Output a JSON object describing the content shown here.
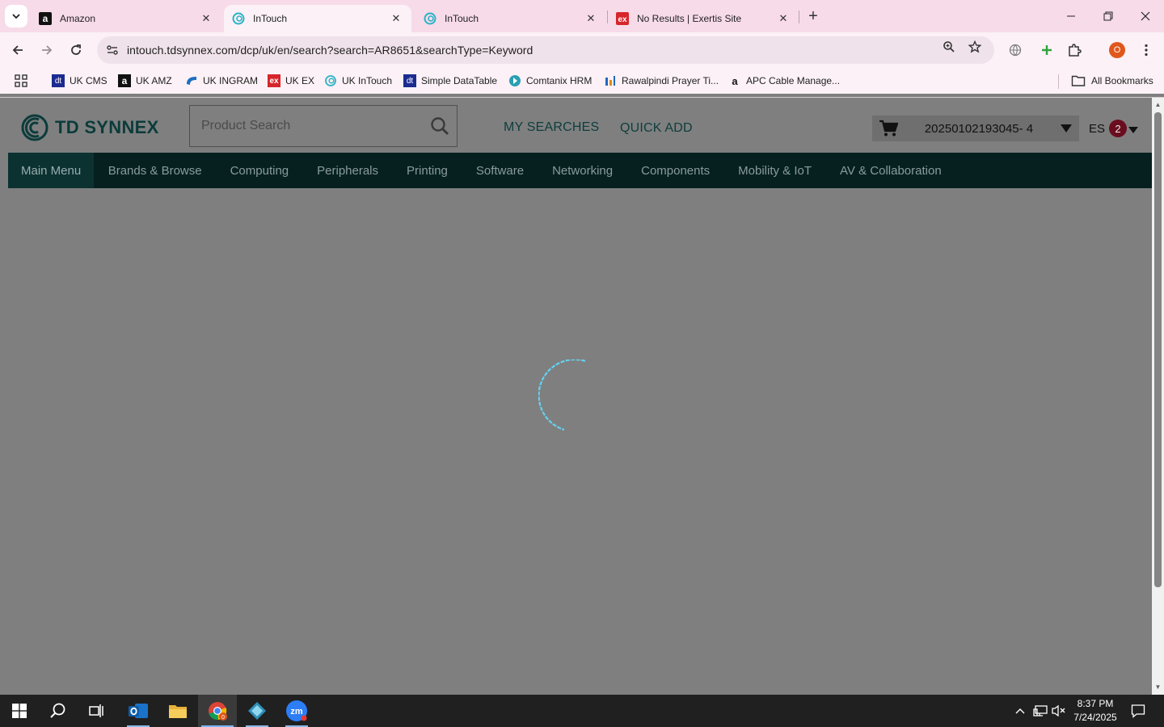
{
  "browser": {
    "tabs": [
      {
        "title": "Amazon",
        "icon": "amazon-icon",
        "active": false
      },
      {
        "title": "InTouch",
        "icon": "intouch-icon",
        "active": true
      },
      {
        "title": "InTouch",
        "icon": "intouch-icon",
        "active": false
      },
      {
        "title": "No Results | Exertis Site",
        "icon": "exertis-icon",
        "active": false
      }
    ],
    "url": "intouch.tdsynnex.com/dcp/uk/en/search?search=AR8651&searchType=Keyword",
    "profile_initial": "O",
    "bookmarks": [
      {
        "label": "UK CMS",
        "icon": "dt-icon"
      },
      {
        "label": "UK AMZ",
        "icon": "amazon-icon"
      },
      {
        "label": "UK INGRAM",
        "icon": "ingram-icon"
      },
      {
        "label": "UK EX",
        "icon": "exertis-icon"
      },
      {
        "label": "UK InTouch",
        "icon": "intouch-icon"
      },
      {
        "label": "Simple DataTable",
        "icon": "dt-icon"
      },
      {
        "label": "Comtanix HRM",
        "icon": "comtanix-icon"
      },
      {
        "label": "Rawalpindi Prayer Ti...",
        "icon": "prayer-icon"
      },
      {
        "label": "APC Cable Manage...",
        "icon": "amazon-icon"
      }
    ],
    "all_bookmarks": "All Bookmarks"
  },
  "site": {
    "brand": "TD SYNNEX",
    "search_placeholder": "Product Search",
    "my_searches": "MY SEARCHES",
    "quick_add": "QUICK ADD",
    "cart_number": "20250102193045- 4",
    "user_initials": "ES",
    "notification_count": "2",
    "nav": [
      "Main Menu",
      "Brands & Browse",
      "Computing",
      "Peripherals",
      "Printing",
      "Software",
      "Networking",
      "Components",
      "Mobility & IoT",
      "AV & Collaboration"
    ],
    "loading": true
  },
  "taskbar": {
    "apps": [
      "windows-start-icon",
      "search-icon",
      "task-view-icon",
      "outlook-icon",
      "file-explorer-icon",
      "chrome-icon",
      "app-icon",
      "zoom-icon"
    ],
    "chrome_badge": "0",
    "zoom_label": "zm",
    "time": "8:37 PM",
    "date": "7/24/2025"
  },
  "colors": {
    "overlay": "#7f7f7f",
    "nav_bg": "#062020",
    "brand": "#0c3b3b",
    "spinner": "#5fd0f0",
    "badge": "#6a0d1e"
  }
}
